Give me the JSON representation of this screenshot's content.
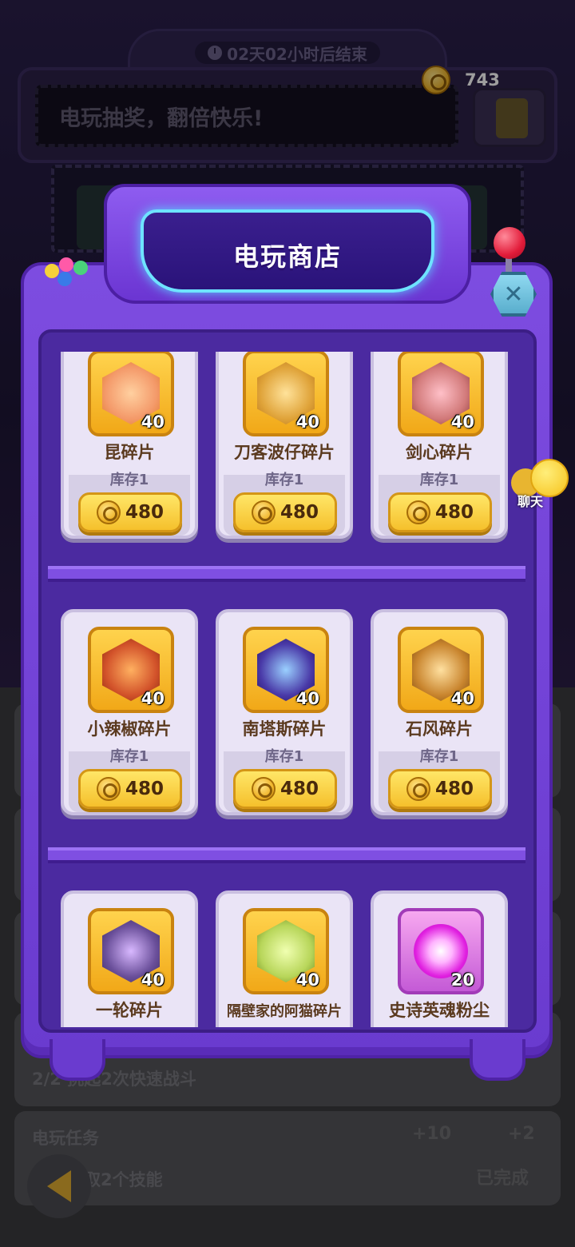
{
  "event": {
    "countdown": "02天02小时后结束",
    "marquee_text": "电玩抽奖，翻倍快乐!"
  },
  "currency": {
    "icon": "paw-coin-icon",
    "amount": "743"
  },
  "shop": {
    "title": "电玩商店",
    "close_icon": "close-icon",
    "items": [
      {
        "name": "昆碎片",
        "qty": "40",
        "stock": "库存1",
        "price": "480",
        "color": "#f49a6a",
        "frame": "gold"
      },
      {
        "name": "刀客波仔碎片",
        "qty": "40",
        "stock": "库存1",
        "price": "480",
        "color": "#e0a43a",
        "frame": "gold"
      },
      {
        "name": "剑心碎片",
        "qty": "40",
        "stock": "库存1",
        "price": "480",
        "color": "#d27a7a",
        "frame": "gold"
      },
      {
        "name": "小辣椒碎片",
        "qty": "40",
        "stock": "库存1",
        "price": "480",
        "color": "#d2522a",
        "frame": "gold"
      },
      {
        "name": "南塔斯碎片",
        "qty": "40",
        "stock": "库存1",
        "price": "480",
        "color": "#4a3aa8",
        "frame": "gold"
      },
      {
        "name": "石风碎片",
        "qty": "40",
        "stock": "库存1",
        "price": "480",
        "color": "#c9852e",
        "frame": "gold"
      },
      {
        "name": "一轮碎片",
        "qty": "40",
        "stock": "",
        "price": "",
        "color": "#6a4f9a",
        "frame": "gold"
      },
      {
        "name": "隔壁家的阿猫碎片",
        "qty": "40",
        "stock": "",
        "price": "",
        "color": "#b8d65a",
        "frame": "gold"
      },
      {
        "name": "史诗英魂粉尘",
        "qty": "20",
        "stock": "",
        "price": "",
        "color": "#e020e0",
        "frame": "epic"
      }
    ]
  },
  "chat": {
    "label": "聊天"
  },
  "background": {
    "slot_text": "2",
    "task_line_1": "2/2 挑起2次快速战斗",
    "task_title": "电玩任务",
    "task_line_2": "抽取2个技能",
    "reward_1": "+10",
    "reward_2": "+2",
    "completed": "已完成"
  }
}
